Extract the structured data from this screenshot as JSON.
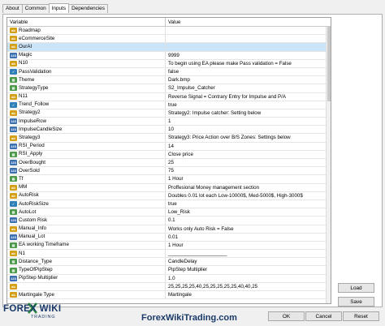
{
  "tabs": [
    {
      "label": "About",
      "active": false
    },
    {
      "label": "Common",
      "active": false
    },
    {
      "label": "Inputs",
      "active": true
    },
    {
      "label": "Dependencies",
      "active": false
    }
  ],
  "grid": {
    "col_variable": "Variable",
    "col_value": "Value",
    "rows": [
      {
        "icon": "ab",
        "name": "Roadmap",
        "value": ""
      },
      {
        "icon": "ab",
        "name": "eCommerceSite",
        "value": ""
      },
      {
        "icon": "ab",
        "name": "OurAI",
        "value": "",
        "selected": true
      },
      {
        "icon": "num",
        "name": "Magic",
        "value": "9999"
      },
      {
        "icon": "ab",
        "name": "N10",
        "value": "To begin using EA please make Pass validation = False"
      },
      {
        "icon": "bool",
        "name": "PassValidation",
        "value": "false"
      },
      {
        "icon": "enum",
        "name": "Theme",
        "value": "Dark.bmp"
      },
      {
        "icon": "enum",
        "name": "StrategyType",
        "value": "S2_Impulse_Catcher"
      },
      {
        "icon": "ab",
        "name": "N11",
        "value": "Reverse Signal = Contrary Entry for Impulse and P/A"
      },
      {
        "icon": "bool",
        "name": "Trend_Follow",
        "value": "true"
      },
      {
        "icon": "ab",
        "name": "Strategy2",
        "value": "Strategy2: Impulse catcher: Setting below"
      },
      {
        "icon": "num",
        "name": "ImpulseRow",
        "value": "1"
      },
      {
        "icon": "num",
        "name": "ImpulseCandleSize",
        "value": "10"
      },
      {
        "icon": "ab",
        "name": "Strategy3",
        "value": "Strategy3: Price Action over B/S Zones: Settings below"
      },
      {
        "icon": "num",
        "name": "RSI_Period",
        "value": "14"
      },
      {
        "icon": "enum",
        "name": "RSI_Apply",
        "value": "Close price"
      },
      {
        "icon": "num",
        "name": "OverBought",
        "value": "25"
      },
      {
        "icon": "num",
        "name": "OverSold",
        "value": "75"
      },
      {
        "icon": "enum",
        "name": "Tf",
        "value": "1 Hour"
      },
      {
        "icon": "ab",
        "name": "MM",
        "value": "Proffesional Money management section"
      },
      {
        "icon": "ab",
        "name": "AutoRisk",
        "value": "Doubles 0.01 lot each Low-10000$, Med-5000$, High-3000$"
      },
      {
        "icon": "bool",
        "name": "AutoRiskSize",
        "value": "true"
      },
      {
        "icon": "enum",
        "name": "AutoLot",
        "value": "Low_Risk"
      },
      {
        "icon": "num",
        "name": "Custom Risk",
        "value": "0.1"
      },
      {
        "icon": "ab",
        "name": "Manual_Info",
        "value": "Works only Auto Risk = False"
      },
      {
        "icon": "num",
        "name": "Manual_Lot",
        "value": "0.01"
      },
      {
        "icon": "enum",
        "name": "EA working Timeframe",
        "value": "1 Hour"
      },
      {
        "icon": "ab",
        "name": "N1",
        "value": "_____________________"
      },
      {
        "icon": "enum",
        "name": "Distance_Type",
        "value": "CandleDelay"
      },
      {
        "icon": "enum",
        "name": "TypeOfPipStep",
        "value": "PipStep Multiplier"
      },
      {
        "icon": "num",
        "name": "PipStep Multiplier",
        "value": "1.0"
      },
      {
        "icon": "ab",
        "name": "",
        "value": "25,25,25,25,40,25,25,25,25,25,40,40,25"
      },
      {
        "icon": "ab",
        "name": "Martingale Type",
        "value": "Martingale"
      }
    ]
  },
  "buttons": {
    "load": "Load",
    "save": "Save",
    "ok": "OK",
    "cancel": "Cancel",
    "reset": "Reset"
  },
  "logo": {
    "line1": "FOREX WIKI",
    "line2": "TRADING"
  },
  "watermark": "ForexWikiTrading.com"
}
